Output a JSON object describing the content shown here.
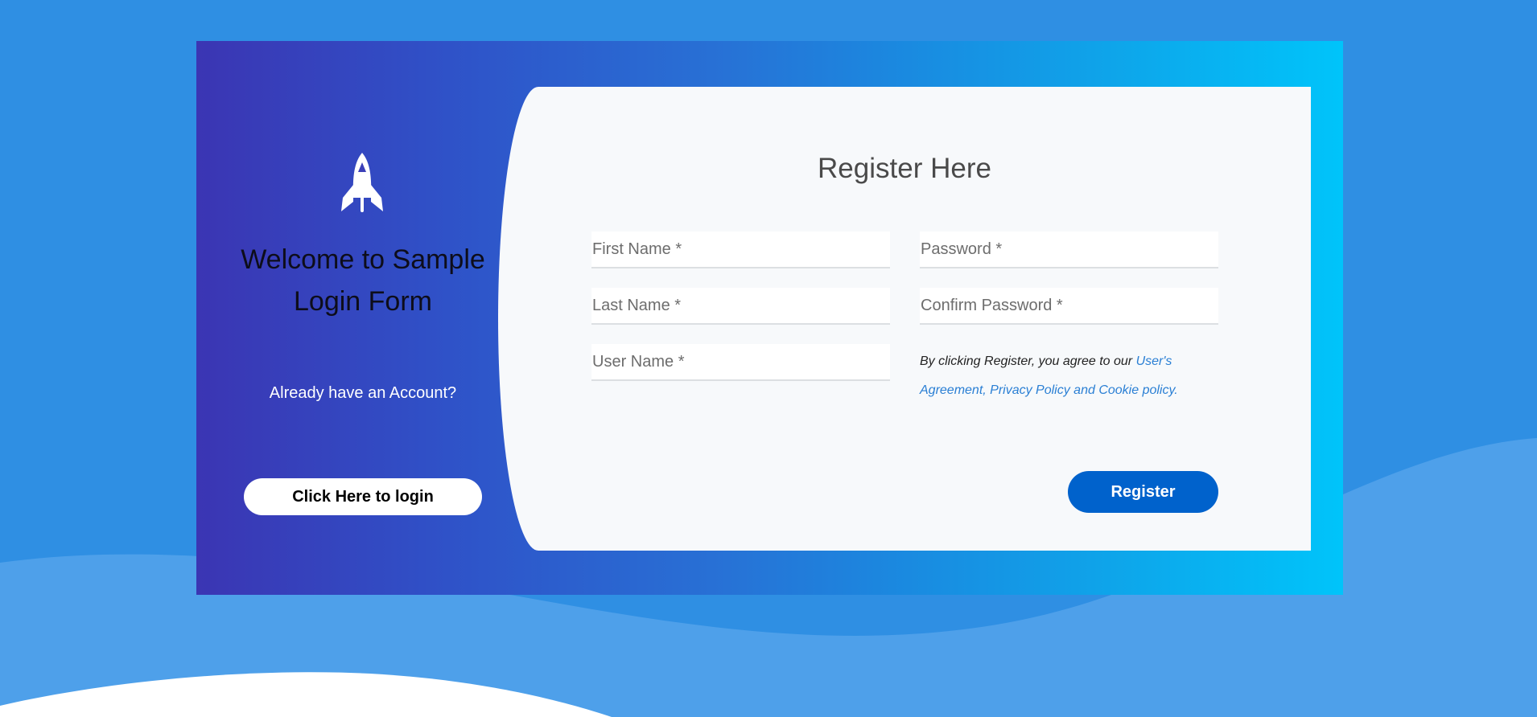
{
  "theme": {
    "page_bg": "#2f8fe3",
    "wave_light": "#4ea0ea",
    "card_gradient_start": "#3b35b3",
    "card_gradient_end": "#00c4fa",
    "form_bg": "#f7f9fb",
    "primary_button": "#0062cc",
    "link_color": "#2a7fd4"
  },
  "left": {
    "icon": "rocket-icon",
    "welcome_title": "Welcome to Sample Login Form",
    "subtitle": "Already have an Account?",
    "login_button_label": "Click Here to login"
  },
  "form": {
    "title": "Register Here",
    "fields": {
      "first_name": {
        "placeholder": "First Name *",
        "value": ""
      },
      "last_name": {
        "placeholder": "Last Name *",
        "value": ""
      },
      "user_name": {
        "placeholder": "User Name *",
        "value": ""
      },
      "password": {
        "placeholder": "Password *",
        "value": ""
      },
      "confirm_password": {
        "placeholder": "Confirm Password *",
        "value": ""
      }
    },
    "terms": {
      "prefix": "By clicking Register, you agree to our ",
      "link_text": "User's Agreement, Privacy Policy and Cookie policy."
    },
    "register_button_label": "Register"
  }
}
